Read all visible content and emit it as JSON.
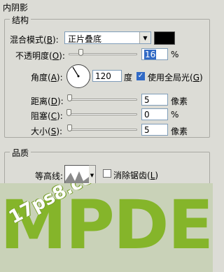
{
  "panel": {
    "title": "内阴影"
  },
  "structure": {
    "title": "结构",
    "blend_mode": {
      "label": "混合模式",
      "key": "B",
      "value": "正片叠底"
    },
    "color_swatch": "#000000",
    "opacity": {
      "label": "不透明度",
      "key": "O",
      "value": "16",
      "unit": "%",
      "level": 0.16
    },
    "angle": {
      "label": "角度",
      "key": "A",
      "value": "120",
      "unit": "度"
    },
    "global_light": {
      "label": "使用全局光",
      "key": "G",
      "checked": true
    },
    "distance": {
      "label": "距离",
      "key": "D",
      "value": "5",
      "unit": "像素",
      "level": 0.02
    },
    "choke": {
      "label": "阻塞",
      "key": "C",
      "value": "0",
      "unit": "%",
      "level": 0.0
    },
    "size": {
      "label": "大小",
      "key": "S",
      "value": "5",
      "unit": "像素",
      "level": 0.02
    }
  },
  "quality": {
    "title": "品质",
    "contour": {
      "label": "等高线:"
    },
    "anti_alias": {
      "label": "消除锯齿",
      "key": "L",
      "checked": false
    }
  },
  "artwork": {
    "text": "MPDE",
    "watermark": "17ps8.com",
    "color_accent": "#85b52a"
  }
}
